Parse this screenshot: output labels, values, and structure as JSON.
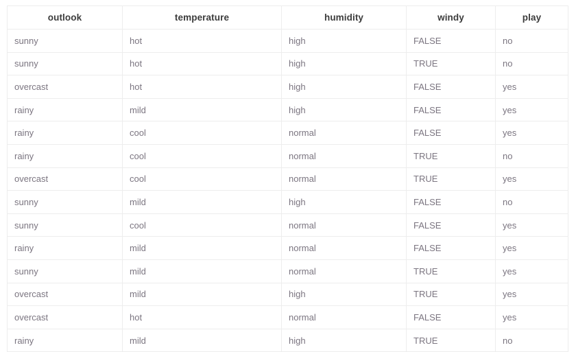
{
  "table": {
    "columns": [
      {
        "key": "outlook",
        "label": "outlook"
      },
      {
        "key": "temperature",
        "label": "temperature"
      },
      {
        "key": "humidity",
        "label": "humidity"
      },
      {
        "key": "windy",
        "label": "windy"
      },
      {
        "key": "play",
        "label": "play"
      }
    ],
    "rows": [
      [
        "sunny",
        "hot",
        "high",
        "FALSE",
        "no"
      ],
      [
        "sunny",
        "hot",
        "high",
        "TRUE",
        "no"
      ],
      [
        "overcast",
        "hot",
        "high",
        "FALSE",
        "yes"
      ],
      [
        "rainy",
        "mild",
        "high",
        "FALSE",
        "yes"
      ],
      [
        "rainy",
        "cool",
        "normal",
        "FALSE",
        "yes"
      ],
      [
        "rainy",
        "cool",
        "normal",
        "TRUE",
        "no"
      ],
      [
        "overcast",
        "cool",
        "normal",
        "TRUE",
        "yes"
      ],
      [
        "sunny",
        "mild",
        "high",
        "FALSE",
        "no"
      ],
      [
        "sunny",
        "cool",
        "normal",
        "FALSE",
        "yes"
      ],
      [
        "rainy",
        "mild",
        "normal",
        "FALSE",
        "yes"
      ],
      [
        "sunny",
        "mild",
        "normal",
        "TRUE",
        "yes"
      ],
      [
        "overcast",
        "mild",
        "high",
        "TRUE",
        "yes"
      ],
      [
        "overcast",
        "hot",
        "normal",
        "FALSE",
        "yes"
      ],
      [
        "rainy",
        "mild",
        "high",
        "TRUE",
        "no"
      ]
    ],
    "row_count": 14,
    "column_count": 5,
    "colors": {
      "background": "#ffffff",
      "gridline": "#ededed",
      "header_text": "#3c3c3c",
      "body_text": "#7b7580"
    }
  }
}
